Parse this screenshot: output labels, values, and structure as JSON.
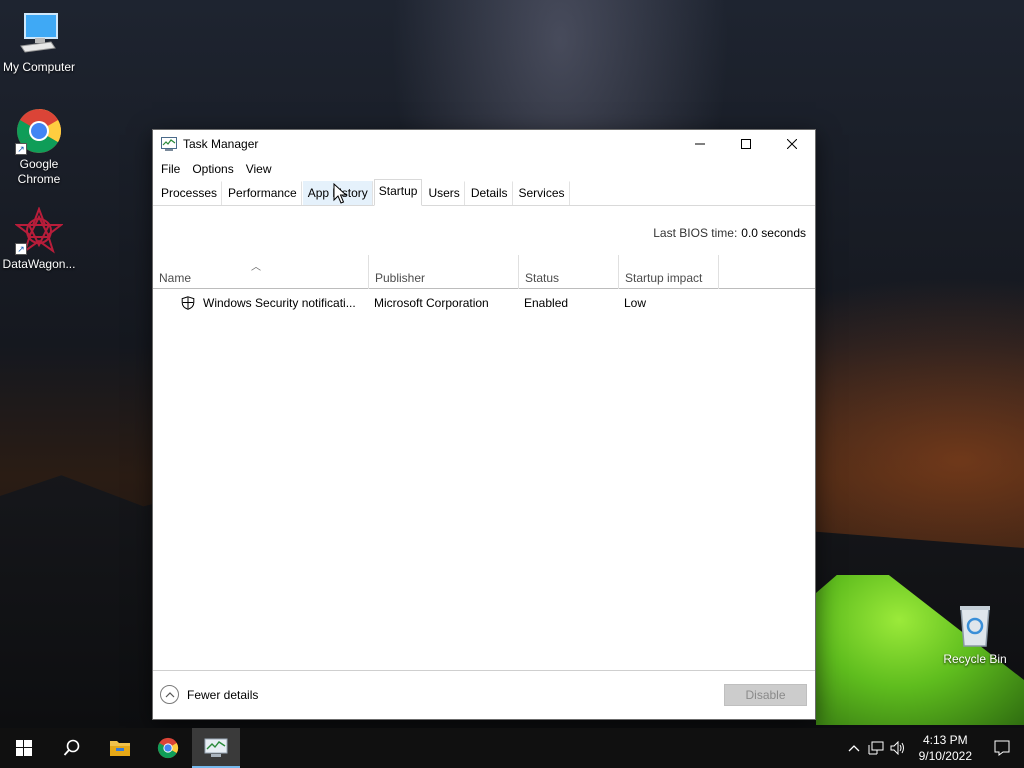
{
  "desktop": {
    "icons": [
      {
        "label": "My Computer",
        "icon": "computer-icon"
      },
      {
        "label": "Google Chrome",
        "icon": "chrome-icon"
      },
      {
        "label": "DataWagon...",
        "icon": "datawagon-icon"
      },
      {
        "label": "Recycle Bin",
        "icon": "recycle-bin-icon"
      }
    ]
  },
  "window": {
    "title": "Task Manager",
    "menu": [
      "File",
      "Options",
      "View"
    ],
    "tabs": [
      "Processes",
      "Performance",
      "App history",
      "Startup",
      "Users",
      "Details",
      "Services"
    ],
    "active_tab": "Startup",
    "bios_label": "Last BIOS time:",
    "bios_value": "0.0 seconds",
    "columns": [
      "Name",
      "Publisher",
      "Status",
      "Startup impact"
    ],
    "rows": [
      {
        "name": "Windows Security notificati...",
        "publisher": "Microsoft Corporation",
        "status": "Enabled",
        "impact": "Low",
        "icon": "shield-icon"
      }
    ],
    "fewer_details": "Fewer details",
    "disable_label": "Disable"
  },
  "taskbar": {
    "time": "4:13 PM",
    "date": "9/10/2022",
    "accent": "#76b9ed"
  }
}
